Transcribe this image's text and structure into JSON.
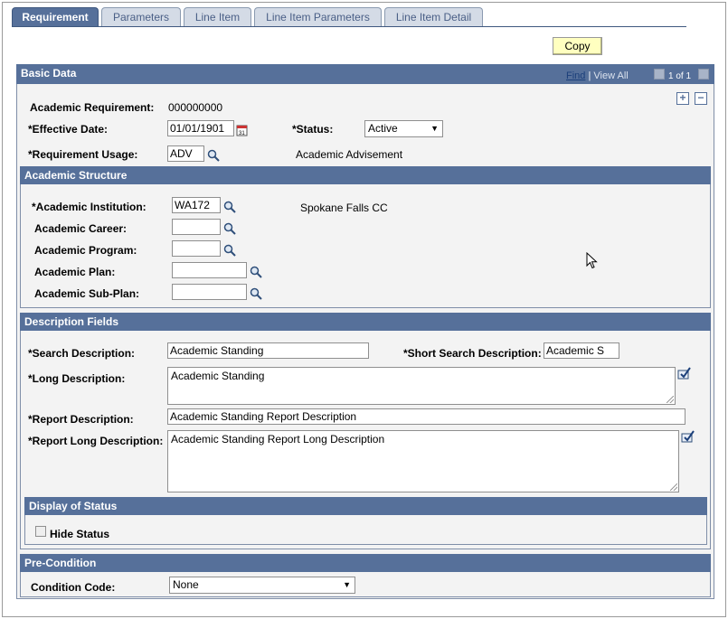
{
  "tabs": [
    {
      "label": "Requirement"
    },
    {
      "label": "Parameters"
    },
    {
      "label": "Line Item"
    },
    {
      "label": "Line Item Parameters"
    },
    {
      "label": "Line Item Detail"
    }
  ],
  "toolbar": {
    "copy_label": "Copy"
  },
  "basic_data": {
    "title": "Basic Data",
    "find_label": "Find",
    "view_all_label": "View All",
    "paging": "1 of 1",
    "academic_requirement_label": "Academic Requirement:",
    "academic_requirement_value": "000000000",
    "effective_date_label": "*Effective Date:",
    "effective_date_value": "01/01/1901",
    "status_label": "*Status:",
    "status_value": "Active",
    "requirement_usage_label": "*Requirement Usage:",
    "requirement_usage_value": "ADV",
    "requirement_usage_desc": "Academic Advisement"
  },
  "academic_structure": {
    "title": "Academic Structure",
    "institution_label": "*Academic Institution:",
    "institution_value": "WA172",
    "institution_desc": "Spokane Falls CC",
    "career_label": "Academic Career:",
    "career_value": "",
    "program_label": "Academic Program:",
    "program_value": "",
    "plan_label": "Academic Plan:",
    "plan_value": "",
    "subplan_label": "Academic Sub-Plan:",
    "subplan_value": ""
  },
  "description_fields": {
    "title": "Description Fields",
    "search_desc_label": "*Search Description:",
    "search_desc_value": "Academic Standing",
    "short_search_label": "*Short Search Description:",
    "short_search_value": "Academic S",
    "long_desc_label": "*Long Description:",
    "long_desc_value": "Academic Standing",
    "report_desc_label": "*Report Description:",
    "report_desc_value": "Academic Standing Report Description",
    "report_long_label": "*Report Long Description:",
    "report_long_value": "Academic Standing Report Long Description"
  },
  "display_status": {
    "title": "Display of Status",
    "hide_status_label": "Hide Status"
  },
  "pre_condition": {
    "title": "Pre-Condition",
    "condition_code_label": "Condition Code:",
    "condition_code_value": "None"
  }
}
